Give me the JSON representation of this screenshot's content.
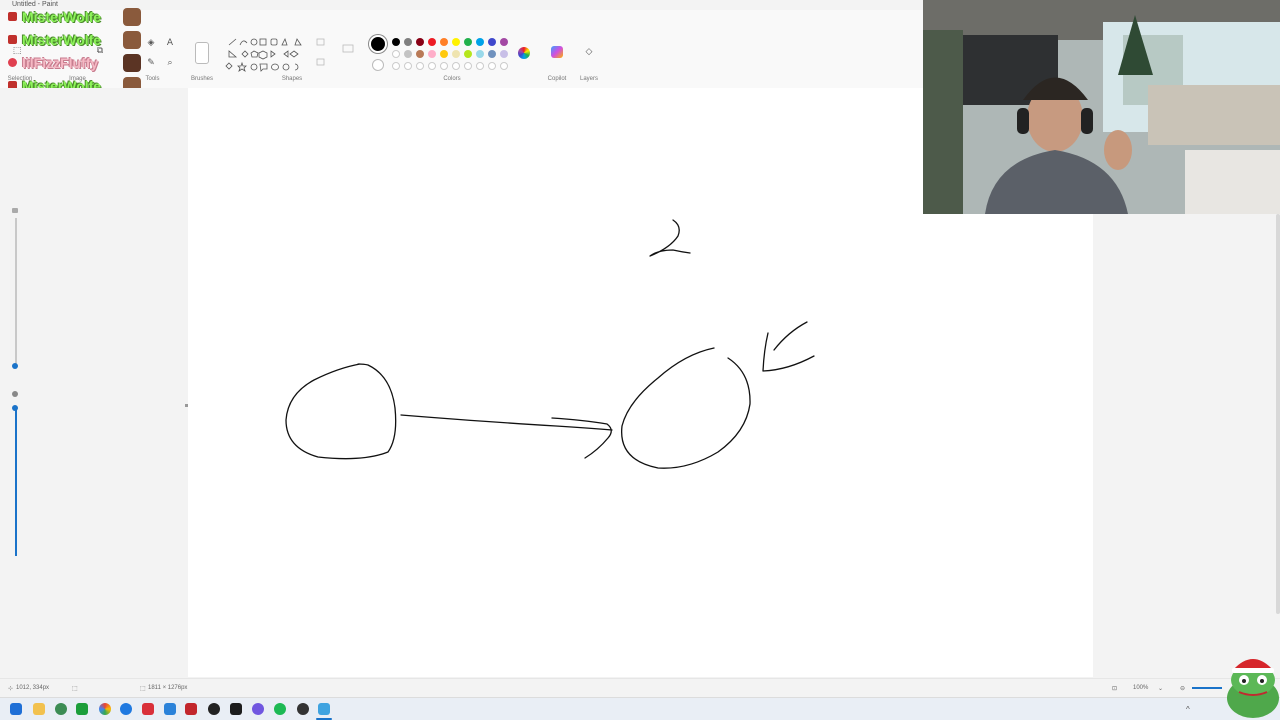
{
  "window": {
    "title": "Untitled - Paint"
  },
  "ribbon": {
    "groups": {
      "selection": "Selection",
      "image": "Image",
      "tools": "Tools",
      "brushes": "Brushes",
      "shapes": "Shapes",
      "colors": "Colors",
      "copilot": "Copilot",
      "layers": "Layers"
    },
    "palette": [
      "#000000",
      "#7f7f7f",
      "#880015",
      "#ed1c24",
      "#ff7f27",
      "#fff200",
      "#22b14c",
      "#00a2e8",
      "#3f48cc",
      "#a349a4",
      "#ffffff",
      "#c3c3c3",
      "#b97a57",
      "#ffaec9",
      "#ffc90e",
      "#efe4b0",
      "#b5e61d",
      "#99d9ea",
      "#7092be",
      "#c8bfe7"
    ],
    "active_color": "#000000"
  },
  "chat": {
    "messages": [
      {
        "user": "MisterWolfe",
        "color": "#8df35a"
      },
      {
        "user": "MisterWolfe",
        "color": "#8df35a"
      },
      {
        "user": "lilFizzFluffy",
        "color": "#f5b8c4"
      },
      {
        "user": "MisterWolfe",
        "color": "#8df35a"
      }
    ]
  },
  "canvas": {
    "handwritten_text": "2"
  },
  "status": {
    "cursor_position": "1012, 334px",
    "canvas_size": "1811 × 1276px",
    "zoom": "100%"
  },
  "taskbar": {
    "icons": [
      "start-icon",
      "file-explorer-icon",
      "app-icon",
      "spreadsheet-icon",
      "chrome-icon",
      "edge-icon",
      "store-icon",
      "settings-icon",
      "obs-icon",
      "xbox-icon",
      "spotify-icon",
      "chrome-alt-icon",
      "paint-icon"
    ]
  }
}
